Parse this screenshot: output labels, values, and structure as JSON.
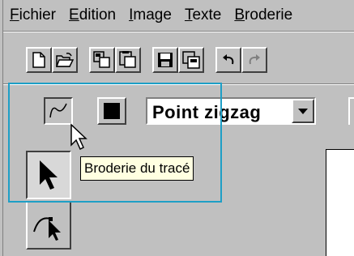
{
  "menu": {
    "items": [
      {
        "label": "Fichier",
        "accel": "F",
        "rest": "ichier"
      },
      {
        "label": "Edition",
        "accel": "E",
        "rest": "dition"
      },
      {
        "label": "Image",
        "accel": "I",
        "rest": "mage"
      },
      {
        "label": "Texte",
        "accel": "T",
        "rest": "exte"
      },
      {
        "label": "Broderie",
        "accel": "B",
        "rest": "roderie"
      }
    ]
  },
  "toolbar": {
    "buttons": [
      "new-doc-icon",
      "open-folder-icon",
      "copy-icon",
      "paste-icon",
      "save-icon",
      "save-as-icon",
      "undo-icon",
      "redo-icon"
    ]
  },
  "stitch_toolbar": {
    "stitch_combo_value": "Point zigzag",
    "tooltip": "Broderie du tracé"
  },
  "colors": {
    "window_bg": "#c0c0c0",
    "tooltip_bg": "#ffffe1",
    "callout_border": "#1e9fc6"
  }
}
